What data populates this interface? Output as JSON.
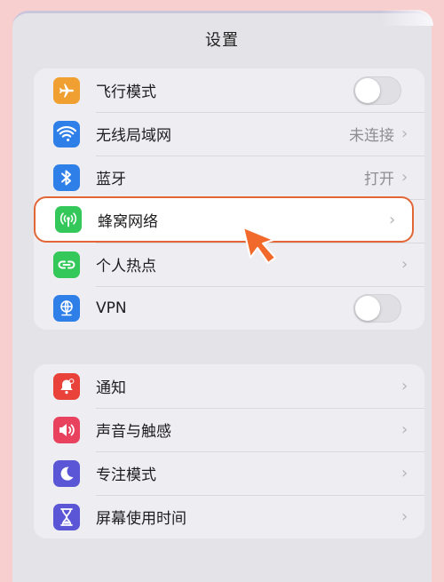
{
  "header": {
    "title": "设置"
  },
  "group1": {
    "items": [
      {
        "label": "飞行模式",
        "icon": "airplane-icon",
        "color": "#f0a030",
        "control": "toggle",
        "on": false
      },
      {
        "label": "无线局域网",
        "icon": "wifi-icon",
        "color": "#2f7fe8",
        "value": "未连接"
      },
      {
        "label": "蓝牙",
        "icon": "bluetooth-icon",
        "color": "#2f7fe8",
        "value": "打开"
      },
      {
        "label": "蜂窝网络",
        "icon": "cellular-icon",
        "color": "#34c759",
        "highlighted": true
      },
      {
        "label": "个人热点",
        "icon": "hotspot-icon",
        "color": "#34c759"
      },
      {
        "label": "VPN",
        "icon": "vpn-icon",
        "color": "#2f7fe8",
        "control": "toggle",
        "on": false
      }
    ]
  },
  "group2": {
    "items": [
      {
        "label": "通知",
        "icon": "bell-icon",
        "color": "#e8423b"
      },
      {
        "label": "声音与触感",
        "icon": "speaker-icon",
        "color": "#e8425e"
      },
      {
        "label": "专注模式",
        "icon": "moon-icon",
        "color": "#5b56d6"
      },
      {
        "label": "屏幕使用时间",
        "icon": "hourglass-icon",
        "color": "#5b56d6"
      }
    ]
  },
  "chevron_glyph": "›",
  "highlight_color": "#e26636"
}
